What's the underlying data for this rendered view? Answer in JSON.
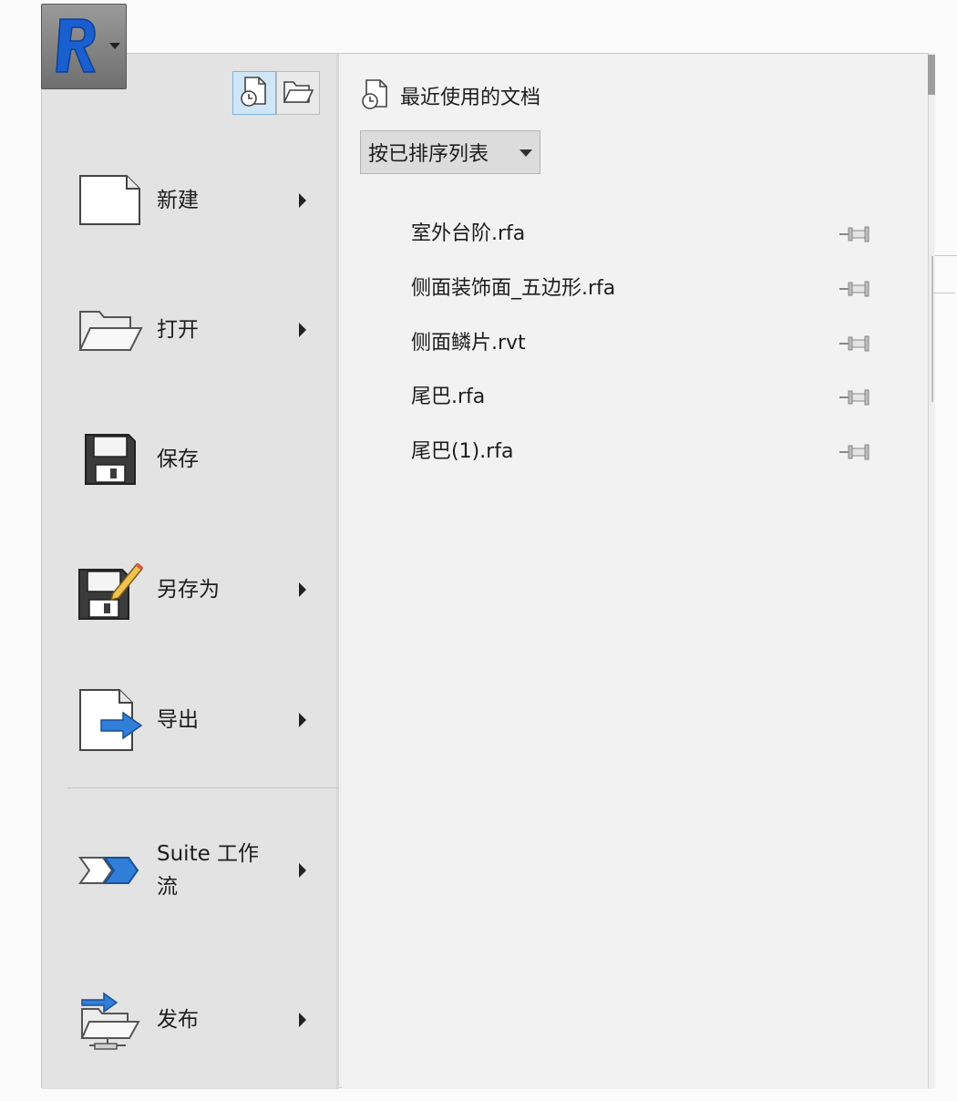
{
  "app_button": {
    "logo_letter": "R",
    "logo_color": "#1a5fd0"
  },
  "view_toggles": [
    {
      "icon": "recent-documents-icon",
      "active": true
    },
    {
      "icon": "open-documents-icon",
      "active": false
    }
  ],
  "menu": {
    "items": [
      {
        "label": "新建",
        "icon": "new-document-icon",
        "submenu": true
      },
      {
        "label": "打开",
        "icon": "open-folder-icon",
        "submenu": true
      },
      {
        "label": "保存",
        "icon": "save-disk-icon",
        "submenu": false
      },
      {
        "label": "另存为",
        "icon": "save-as-icon",
        "submenu": true
      },
      {
        "label": "导出",
        "icon": "export-icon",
        "submenu": true
      },
      {
        "label": "Suite 工作流",
        "icon": "suite-workflow-icon",
        "submenu": true
      },
      {
        "label": "发布",
        "icon": "publish-icon",
        "submenu": true
      }
    ]
  },
  "recent": {
    "title": "最近使用的文档",
    "sort_label": "按已排序列表",
    "files": [
      {
        "name": "室外台阶.rfa"
      },
      {
        "name": "侧面装饰面_五边形.rfa"
      },
      {
        "name": "侧面鳞片.rvt"
      },
      {
        "name": "尾巴.rfa"
      },
      {
        "name": "尾巴(1).rfa"
      }
    ]
  },
  "colors": {
    "accent_blue": "#2f7fd8",
    "left_pane": "#e3e3e3",
    "right_pane": "#f2f2f2"
  }
}
